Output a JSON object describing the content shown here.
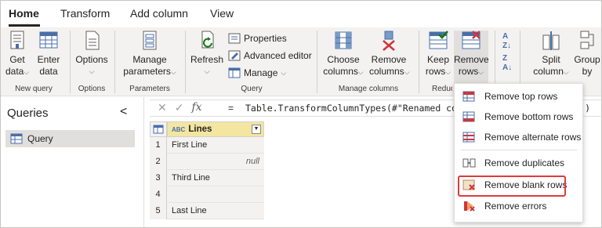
{
  "tabs": [
    {
      "label": "Home",
      "active": true
    },
    {
      "label": "Transform",
      "active": false
    },
    {
      "label": "Add column",
      "active": false
    },
    {
      "label": "View",
      "active": false
    }
  ],
  "ribbon": {
    "groups": {
      "new_query": "New query",
      "options": "Options",
      "parameters": "Parameters",
      "query": "Query",
      "manage_columns": "Manage columns",
      "reduce": "Reduc"
    },
    "get_data": [
      "Get",
      "data"
    ],
    "enter_data": [
      "Enter",
      "data"
    ],
    "options_btn": "Options",
    "manage_parameters": [
      "Manage",
      "parameters"
    ],
    "refresh": "Refresh",
    "properties": "Properties",
    "advanced_editor": "Advanced editor",
    "manage": "Manage",
    "choose_columns": [
      "Choose",
      "columns"
    ],
    "remove_columns": [
      "Remove",
      "columns"
    ],
    "keep_rows": [
      "Keep",
      "rows"
    ],
    "remove_rows": [
      "Remove",
      "rows"
    ],
    "split_column": [
      "Split",
      "column"
    ],
    "group_by": [
      "Group",
      "by"
    ]
  },
  "queries": {
    "title": "Queries",
    "collapse_glyph": "<",
    "items": [
      "Query"
    ]
  },
  "formula_bar": {
    "cancel_glyph": "✕",
    "commit_glyph": "✓",
    "fx": "fx",
    "equals": "=",
    "formula": "Table.TransformColumnTypes(#\"Renamed colum",
    "formula_end": ")"
  },
  "grid": {
    "column_type": "ABC",
    "column_name": "Lines",
    "rows": [
      {
        "num": "1",
        "value": "First Line",
        "is_null": false
      },
      {
        "num": "2",
        "value": "null",
        "is_null": true
      },
      {
        "num": "3",
        "value": "Third Line",
        "is_null": false
      },
      {
        "num": "4",
        "value": "",
        "is_null": false
      },
      {
        "num": "5",
        "value": "Last Line",
        "is_null": false
      }
    ]
  },
  "menu": {
    "items": [
      "Remove top rows",
      "Remove bottom rows",
      "Remove alternate rows",
      "Remove duplicates",
      "Remove blank rows",
      "Remove errors"
    ],
    "highlighted": "Remove blank rows"
  },
  "colors": {
    "accent_red": "#e0393e",
    "column_header": "#f2e6a0",
    "ribbon_bg": "#f3f2f1",
    "icon_blue": "#4a6ea8"
  }
}
